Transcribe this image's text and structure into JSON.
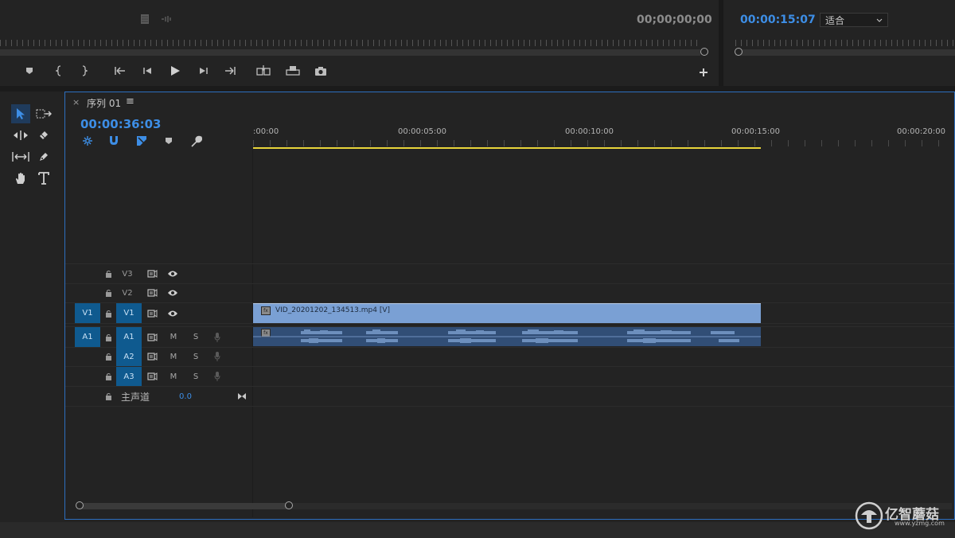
{
  "source_monitor": {
    "timecode": "00;00;00;00",
    "transport_buttons": [
      "add-marker",
      "mark-in",
      "mark-out",
      "go-to-in",
      "step-back",
      "play",
      "step-forward",
      "go-to-out",
      "insert",
      "overwrite",
      "export-frame",
      "add-button"
    ]
  },
  "program_monitor": {
    "timecode": "00:00:15:07",
    "fit_label": "适合"
  },
  "timeline": {
    "tab": {
      "close": "×",
      "label": "序列 01",
      "menu": "≡"
    },
    "timecode": "00:00:36:03",
    "ruler": {
      "start_label": ":00:00",
      "labels": [
        "00:00:05:00",
        "00:00:10:00",
        "00:00:15:00",
        "00:00:20:00"
      ]
    },
    "video_tracks": [
      {
        "name": "V3"
      },
      {
        "name": "V2"
      },
      {
        "name": "V1",
        "source_patch": "V1"
      }
    ],
    "audio_tracks": [
      {
        "name": "A1",
        "source_patch": "A1",
        "mute": "M",
        "solo": "S"
      },
      {
        "name": "A2",
        "mute": "M",
        "solo": "S"
      },
      {
        "name": "A3",
        "mute": "M",
        "solo": "S"
      }
    ],
    "master": {
      "label": "主声道",
      "value": "0.0"
    },
    "video_clip": {
      "name": "VID_20201202_134513.mp4 [V]",
      "fx": "fx"
    },
    "audio_clip": {
      "fx": "fx"
    }
  },
  "watermark": {
    "name": "亿智蘑菇",
    "url": "www.yzmg.com"
  },
  "colors": {
    "accent": "#3d8ee6",
    "video_clip": "#7aa0d4",
    "audio_clip": "#314e76",
    "patch": "#0f5a8f",
    "work_area": "#e8d43a"
  }
}
